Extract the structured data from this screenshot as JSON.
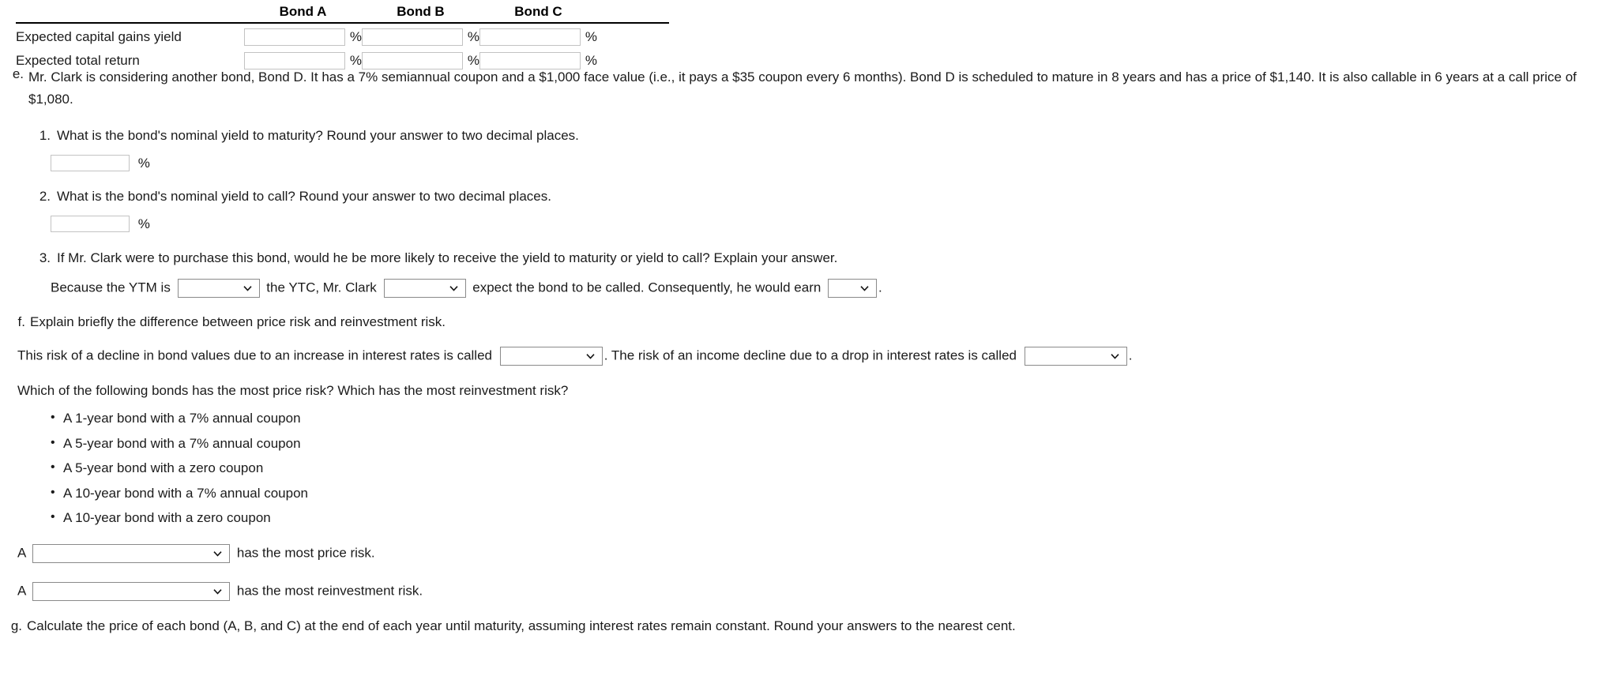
{
  "table": {
    "column_headers": [
      "",
      "Bond A",
      "Bond B",
      "Bond C"
    ],
    "rows": [
      {
        "label": "Expected capital gains yield",
        "values": [
          "",
          "",
          ""
        ],
        "unit": "%"
      },
      {
        "label": "Expected total return",
        "values": [
          "",
          "",
          ""
        ],
        "unit": "%"
      }
    ],
    "unit_symbol": "%"
  },
  "section_e": {
    "marker": "e.",
    "text": "Mr. Clark is considering another bond, Bond D. It has a 7% semiannual coupon and a $1,000 face value (i.e., it pays a $35 coupon every 6 months). Bond D is scheduled to mature in 8 years and has a price of $1,140. It is also callable in 6 years at a call price of $1,080.",
    "items": [
      {
        "marker": "1.",
        "text": "What is the bond's nominal yield to maturity? Round your answer to two decimal places.",
        "answer_value": "",
        "unit": "%"
      },
      {
        "marker": "2.",
        "text": "What is the bond's nominal yield to call? Round your answer to two decimal places.",
        "answer_value": "",
        "unit": "%"
      },
      {
        "marker": "3.",
        "text": "If Mr. Clark were to purchase this bond, would he be more likely to receive the yield to maturity or yield to call? Explain your answer.",
        "sentence": {
          "part1": "Because the YTM is",
          "dropdown1_value": "",
          "part2": "the YTC, Mr. Clark",
          "dropdown2_value": "",
          "part3": "expect the bond to be called. Consequently, he would earn",
          "dropdown3_value": "",
          "part4": "."
        }
      }
    ]
  },
  "section_f": {
    "marker": "f.",
    "text": "Explain briefly the difference between price risk and reinvestment risk.",
    "risk_sentence": {
      "part1": "This risk of a decline in bond values due to an increase in interest rates is called",
      "dropdown1_value": "",
      "part2": ". The risk of an income decline due to a drop in interest rates is called",
      "dropdown2_value": "",
      "part3": "."
    },
    "question": "Which of the following bonds has the most price risk? Which has the most reinvestment risk?",
    "bonds": [
      "A 1-year bond with a 7% annual coupon",
      "A 5-year bond with a 7% annual coupon",
      "A 5-year bond with a zero coupon",
      "A 10-year bond with a 7% annual coupon",
      "A 10-year bond with a zero coupon"
    ],
    "price_risk_answer": {
      "prefix": "A",
      "dropdown_value": "",
      "suffix": "has the most price risk."
    },
    "reinvestment_risk_answer": {
      "prefix": "A",
      "dropdown_value": "",
      "suffix": "has the most reinvestment risk."
    }
  },
  "section_g": {
    "marker": "g.",
    "text": "Calculate the price of each bond (A, B, and C) at the end of each year until maturity, assuming interest rates remain constant. Round your answers to the nearest cent."
  },
  "icons": {
    "chevron_down": "chevron-down-icon"
  },
  "colors": {
    "text": "#1b1b1b",
    "rule": "#000000",
    "input_border": "#c3c3c3",
    "select_border": "#8a8a8a"
  }
}
